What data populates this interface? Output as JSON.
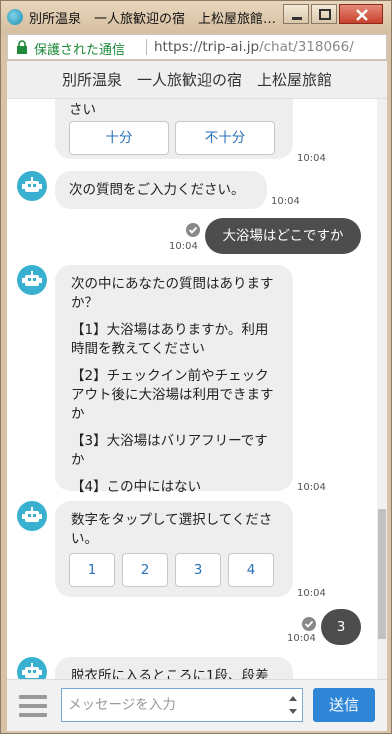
{
  "window": {
    "title": "別所温泉　一人旅歓迎の宿　上松屋旅館の...",
    "minimize_icon": "minimize-icon",
    "maximize_icon": "maximize-icon",
    "close_icon": "close-icon"
  },
  "address_bar": {
    "secure_label": "保護された通信",
    "url_host": "https://trip-ai.jp",
    "url_path": "/chat/318066/"
  },
  "header": {
    "title": "別所温泉　一人旅歓迎の宿　上松屋旅館"
  },
  "chat": {
    "messages": [
      {
        "sender": "bot",
        "text_partial": "さい",
        "buttons": [
          "十分",
          "不十分"
        ],
        "time": "10:04"
      },
      {
        "sender": "bot",
        "text": "次の質問をご入力ください。",
        "time": "10:04"
      },
      {
        "sender": "user",
        "text": "大浴場はどこですか",
        "time": "10:04"
      },
      {
        "sender": "bot",
        "intro": "次の中にあなたの質問はありますか？",
        "options": [
          "【1】大浴場はありますか。利用時間を教えてください",
          "【2】チェックイン前やチェックアウト後に大浴場は利用できますか",
          "【3】大浴場はバリアフリーですか",
          "【4】この中にはない"
        ],
        "time": "10:04"
      },
      {
        "sender": "bot",
        "text": "数字をタップして選択してください。",
        "buttons": [
          "1",
          "2",
          "3",
          "4"
        ],
        "time": "10:04"
      },
      {
        "sender": "user",
        "text": "3",
        "time": "10:04"
      },
      {
        "sender": "bot",
        "text_partial": "脱衣所に入るところに1段、段差"
      }
    ]
  },
  "input": {
    "placeholder": "メッセージを入力",
    "send_label": "送信"
  },
  "colors": {
    "bot_bubble": "#eeeeee",
    "user_bubble": "#4d4d4d",
    "send_button": "#2f86d6",
    "option_text": "#2a72b8",
    "secure_green": "#1e8a3a",
    "avatar": "#3ab0d0"
  }
}
